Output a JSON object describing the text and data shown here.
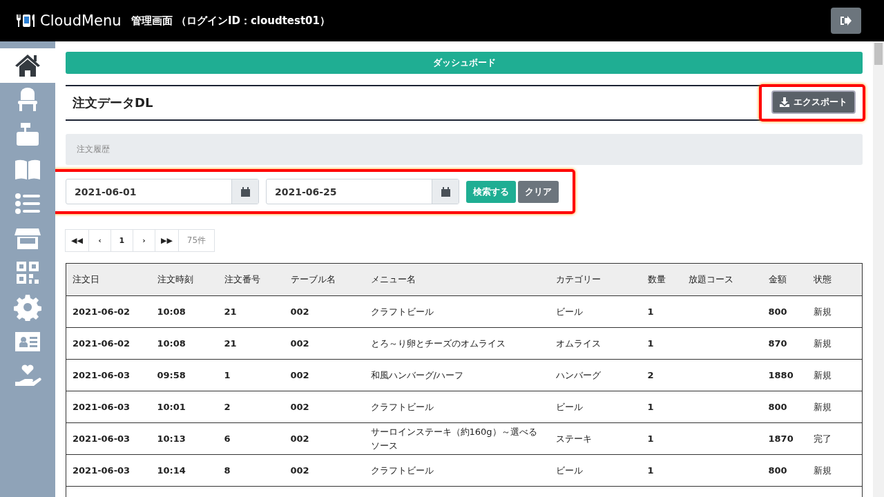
{
  "header": {
    "logo": "CloudMenu",
    "title": "管理画面 （ログインID：cloudtest01）"
  },
  "sidebar": {
    "items": [
      {
        "kind": "home",
        "selected": true
      },
      {
        "kind": "chair",
        "selected": false
      },
      {
        "kind": "register",
        "selected": false
      },
      {
        "kind": "book",
        "selected": false
      },
      {
        "kind": "list",
        "selected": false
      },
      {
        "kind": "store",
        "selected": false
      },
      {
        "kind": "qr",
        "selected": false
      },
      {
        "kind": "gear",
        "selected": false
      },
      {
        "kind": "idcard",
        "selected": false
      },
      {
        "kind": "hand",
        "selected": false
      }
    ]
  },
  "dashboard_button": "ダッシュボード",
  "page_title": "注文データDL",
  "export_button": "エクスポート",
  "breadcrumb": "注文履歴",
  "filter": {
    "date_from": "2021-06-01",
    "date_to": "2021-06-25",
    "search_button": "検索する",
    "clear_button": "クリア"
  },
  "pagination": {
    "first": "◀◀",
    "prev": "‹",
    "page": "1",
    "next": "›",
    "last": "▶▶",
    "count": "75件"
  },
  "table": {
    "columns": [
      "注文日",
      "注文時刻",
      "注文番号",
      "テーブル名",
      "メニュー名",
      "カテゴリー",
      "数量",
      "放題コース",
      "金額",
      "状態"
    ],
    "rows": [
      [
        "2021-06-02",
        "10:08",
        "21",
        "002",
        "クラフトビール",
        "ビール",
        "1",
        "",
        "800",
        "新規"
      ],
      [
        "2021-06-02",
        "10:08",
        "21",
        "002",
        "とろ～り卵とチーズのオムライス",
        "オムライス",
        "1",
        "",
        "870",
        "新規"
      ],
      [
        "2021-06-03",
        "09:58",
        "1",
        "002",
        "和風ハンバーグ/ハーフ",
        "ハンバーグ",
        "2",
        "",
        "1880",
        "新規"
      ],
      [
        "2021-06-03",
        "10:01",
        "2",
        "002",
        "クラフトビール",
        "ビール",
        "1",
        "",
        "800",
        "新規"
      ],
      [
        "2021-06-03",
        "10:13",
        "6",
        "002",
        "サーロインステーキ（約160g）～選べるソース",
        "ステーキ",
        "1",
        "",
        "1870",
        "完了"
      ],
      [
        "2021-06-03",
        "10:14",
        "8",
        "002",
        "クラフトビール",
        "ビール",
        "1",
        "",
        "800",
        "新規"
      ]
    ]
  }
}
